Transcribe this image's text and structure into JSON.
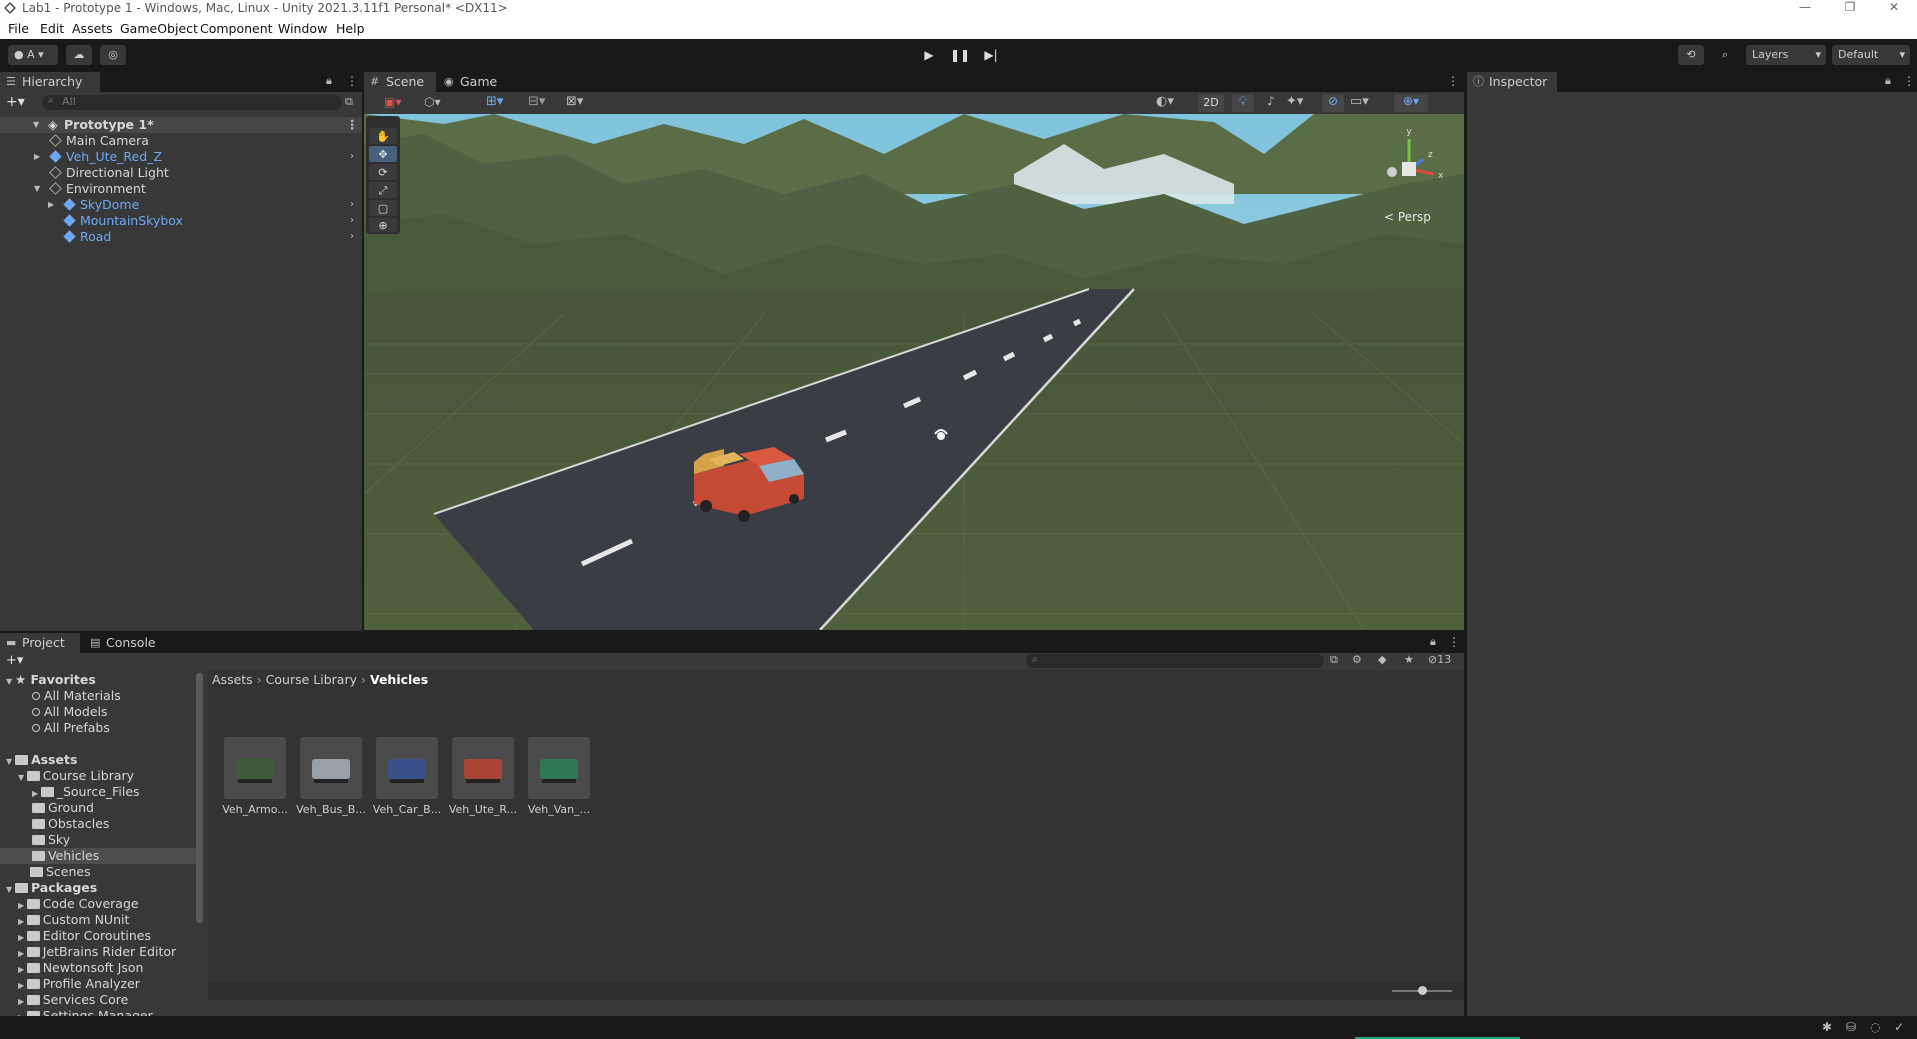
{
  "window": {
    "title": "Lab1 - Prototype 1 - Windows, Mac, Linux - Unity 2021.3.11f1 Personal* <DX11>",
    "controls": [
      "—",
      "❐",
      "✕"
    ]
  },
  "menu": [
    "File",
    "Edit",
    "Assets",
    "GameObject",
    "Component",
    "Window",
    "Help"
  ],
  "toolbar": {
    "account": "A",
    "layers": "Layers",
    "layout": "Default"
  },
  "hierarchy": {
    "tab": "Hierarchy",
    "search_placeholder": "All",
    "scene": "Prototype 1*",
    "items": [
      {
        "label": "Main Camera",
        "indent": 1,
        "prefab": false,
        "foldout": ""
      },
      {
        "label": "Veh_Ute_Red_Z",
        "indent": 1,
        "prefab": true,
        "foldout": "▶"
      },
      {
        "label": "Directional Light",
        "indent": 1,
        "prefab": false,
        "foldout": ""
      },
      {
        "label": "Environment",
        "indent": 1,
        "prefab": false,
        "foldout": "▼"
      },
      {
        "label": "SkyDome",
        "indent": 2,
        "prefab": true,
        "foldout": "▶"
      },
      {
        "label": "MountainSkybox",
        "indent": 2,
        "prefab": true,
        "foldout": ""
      },
      {
        "label": "Road",
        "indent": 2,
        "prefab": true,
        "foldout": ""
      }
    ]
  },
  "scene_view": {
    "tabs": [
      "Scene",
      "Game"
    ],
    "mode_2d": "2D",
    "projection": "Persp",
    "gizmo_axes": [
      "y",
      "z",
      "x"
    ]
  },
  "inspector": {
    "tab": "Inspector"
  },
  "project": {
    "tabs": [
      "Project",
      "Console"
    ],
    "breadcrumb": [
      "Assets",
      "Course Library",
      "Vehicles"
    ],
    "hidden_count": "13",
    "favorites": {
      "label": "Favorites",
      "items": [
        "All Materials",
        "All Models",
        "All Prefabs"
      ]
    },
    "assets_label": "Assets",
    "course_library": "Course Library",
    "course_children": [
      "_Source_Files",
      "Ground",
      "Obstacles",
      "Sky",
      "Vehicles"
    ],
    "scenes": "Scenes",
    "packages_label": "Packages",
    "packages": [
      "Code Coverage",
      "Custom NUnit",
      "Editor Coroutines",
      "JetBrains Rider Editor",
      "Newtonsoft Json",
      "Profile Analyzer",
      "Services Core",
      "Settings Manager"
    ],
    "assets": [
      {
        "label": "Veh_Armo...",
        "color": "#3f5a3a"
      },
      {
        "label": "Veh_Bus_B...",
        "color": "#9aa0a8"
      },
      {
        "label": "Veh_Car_B...",
        "color": "#3b4f8a"
      },
      {
        "label": "Veh_Ute_R...",
        "color": "#a84536"
      },
      {
        "label": "Veh_Van_...",
        "color": "#2f7a52"
      }
    ]
  },
  "colors": {
    "accent_blue": "#6da9f2",
    "panel": "#383838",
    "ground": "#4e5c3b",
    "road": "#3a3d44",
    "truck": "#c44a35"
  }
}
